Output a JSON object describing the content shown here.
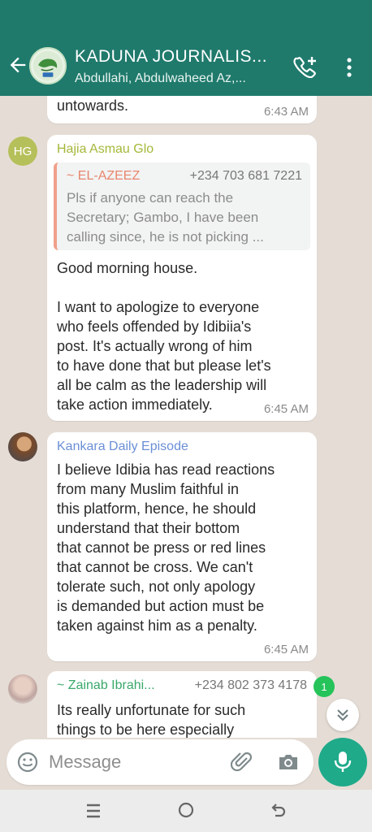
{
  "header": {
    "title": "KADUNA JOURNALIS...",
    "subtitle": "Abdullahi, Abdulwaheed Az,...",
    "colors": {
      "header_bg": "#1f7a6c"
    }
  },
  "messages": [
    {
      "text_partial": "untowards.",
      "time": "6:43 AM"
    },
    {
      "avatar_initials": "HG",
      "sender": "Hajia Asmau Glo",
      "sender_color": "#a5b83a",
      "quote": {
        "name": "~ EL-AZEEZ",
        "phone": "+234 703 681 7221",
        "text": "Pls if anyone can reach the\nSecretary; Gambo, I have been\ncalling since, he is not picking ..."
      },
      "text": "Good morning house.\n\nI want to apologize to everyone\nwho feels offended by Idibiia's\npost. It's actually wrong of him\nto have done that but please let's\nall be calm as the leadership will\ntake action immediately.",
      "time": "6:45 AM"
    },
    {
      "sender": "Kankara Daily Episode",
      "sender_color": "#6b8fd6",
      "text": "I believe Idibia has read reactions\nfrom many Muslim faithful in\nthis platform, hence, he should\nunderstand that their bottom\nthat cannot be press or red lines\nthat cannot be cross. We can't\ntolerate such, not only apology\nis demanded but action must be\ntaken against him as a penalty.",
      "time": "6:45 AM"
    },
    {
      "sender": "~ Zainab Ibrahi...",
      "sender_color": "#3aa86a",
      "phone": "+234 802 373 4178",
      "text": "Its really unfortunate for such\nthings to be here especially"
    }
  ],
  "unread_badge": "1",
  "composer": {
    "placeholder": "Message"
  },
  "icons": [
    "back-arrow-icon",
    "group-logo-icon",
    "add-call-icon",
    "more-vert-icon",
    "emoji-icon",
    "attach-icon",
    "camera-icon",
    "mic-icon",
    "chevron-double-down-icon",
    "recents-icon",
    "home-icon",
    "back-icon"
  ]
}
